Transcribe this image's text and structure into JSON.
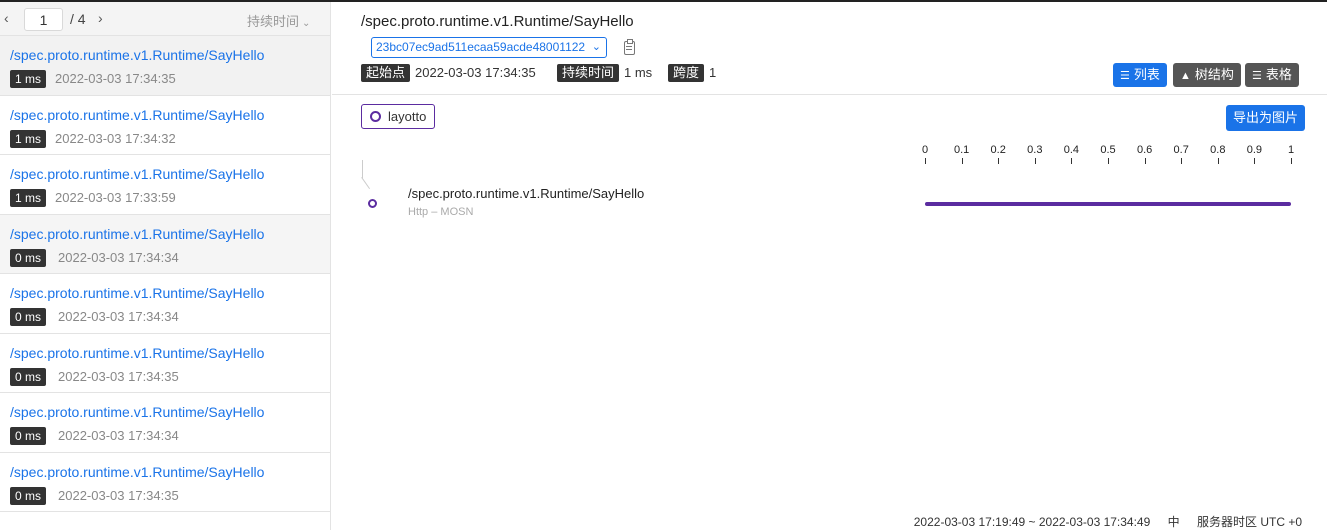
{
  "pager": {
    "prev_icon": "‹",
    "next_icon": "›",
    "current_page": "1",
    "total": "/ 4",
    "sort_label": "持续时间"
  },
  "trace_list": [
    {
      "operation": "/spec.proto.runtime.v1.Runtime/SayHello",
      "duration": "1 ms",
      "time": "2022-03-03 17:34:35"
    },
    {
      "operation": "/spec.proto.runtime.v1.Runtime/SayHello",
      "duration": "1 ms",
      "time": "2022-03-03 17:34:32"
    },
    {
      "operation": "/spec.proto.runtime.v1.Runtime/SayHello",
      "duration": "1 ms",
      "time": "2022-03-03 17:33:59"
    },
    {
      "operation": "/spec.proto.runtime.v1.Runtime/SayHello",
      "duration": "0 ms",
      "time": "2022-03-03 17:34:34"
    },
    {
      "operation": "/spec.proto.runtime.v1.Runtime/SayHello",
      "duration": "0 ms",
      "time": "2022-03-03 17:34:34"
    },
    {
      "operation": "/spec.proto.runtime.v1.Runtime/SayHello",
      "duration": "0 ms",
      "time": "2022-03-03 17:34:35"
    },
    {
      "operation": "/spec.proto.runtime.v1.Runtime/SayHello",
      "duration": "0 ms",
      "time": "2022-03-03 17:34:34"
    },
    {
      "operation": "/spec.proto.runtime.v1.Runtime/SayHello",
      "duration": "0 ms",
      "time": "2022-03-03 17:34:35"
    }
  ],
  "detail": {
    "title": "/spec.proto.runtime.v1.Runtime/SayHello",
    "trace_id": "23bc07ec9ad511ecaa59acde48001122",
    "start_label": "起始点",
    "start_value": "2022-03-03 17:34:35",
    "duration_label": "持续时间",
    "duration_value": "1 ms",
    "spans_label": "跨度",
    "spans_value": "1",
    "view_list": "列表",
    "view_tree": "树结构",
    "view_table": "表格",
    "active_view": "列表",
    "service": "layotto",
    "export_label": "导出为图片"
  },
  "timeline": {
    "ticks": [
      "0",
      "0.1",
      "0.2",
      "0.3",
      "0.4",
      "0.5",
      "0.6",
      "0.7",
      "0.8",
      "0.9",
      "1"
    ],
    "axis_min": 0,
    "axis_max": 1,
    "span": {
      "name": "/spec.proto.runtime.v1.Runtime/SayHello",
      "sub": "Http – MOSN",
      "start": 0,
      "end": 1,
      "color": "#5b2ca0"
    }
  },
  "footer": {
    "range": "2022-03-03 17:19:49 ~ 2022-03-03 17:34:49",
    "lang": "中",
    "timezone": "服务器时区 UTC +0"
  },
  "colors": {
    "accent": "#1a73e8",
    "service": "#5b2ca0",
    "tag_bg": "#333333"
  }
}
